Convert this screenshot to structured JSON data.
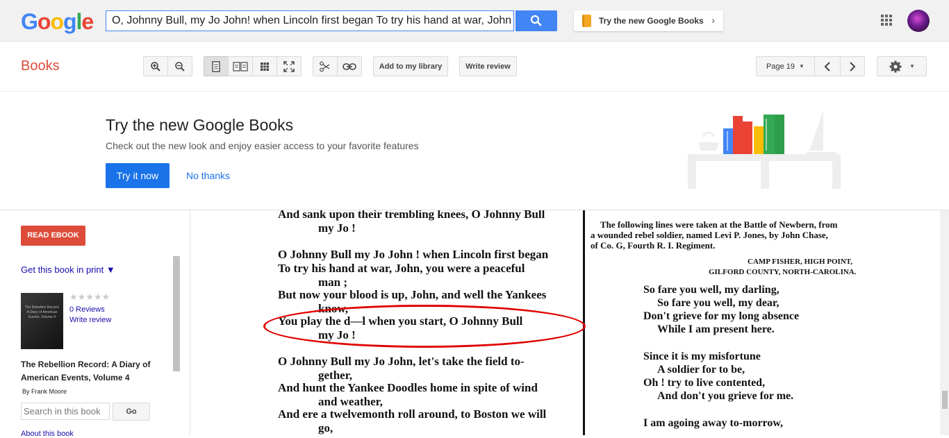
{
  "header": {
    "logo_letters": [
      {
        "ch": "G",
        "color": "#4285f4"
      },
      {
        "ch": "o",
        "color": "#ea4335"
      },
      {
        "ch": "o",
        "color": "#fbbc05"
      },
      {
        "ch": "g",
        "color": "#4285f4"
      },
      {
        "ch": "l",
        "color": "#34a853"
      },
      {
        "ch": "e",
        "color": "#ea4335"
      }
    ],
    "search_value": "O, Johnny Bull, my Jo John! when Lincoln first began To try his hand at war, John",
    "try_new_label": "Try the new Google Books"
  },
  "toolbar": {
    "books_label": "Books",
    "add_library_label": "Add to my library",
    "write_review_label": "Write review",
    "page_label": "Page 19"
  },
  "banner": {
    "title": "Try the new Google Books",
    "subtitle": "Check out the new look and enjoy easier access to your favorite features",
    "try_now_label": "Try it now",
    "no_thanks_label": "No thanks"
  },
  "sidebar": {
    "read_ebook_label": "READ EBOOK",
    "get_print_label": "Get this book in print ▼",
    "stars": "★★★★★",
    "reviews_label": "0 Reviews",
    "write_review_label": "Write review",
    "book_title": "The Rebellion Record: A Diary of American Events, Volume 4",
    "author": "By Frank Moore",
    "search_placeholder": "Search in this book",
    "go_label": "Go",
    "about_label": "About this book"
  },
  "scan": {
    "left_lines": [
      {
        "text": "And sank upon their trembling knees, O Johnny Bull",
        "indent": false
      },
      {
        "text": "my Jo !",
        "indent": true
      },
      {
        "text": "O Johnny Bull my Jo John ! when Lincoln first began",
        "indent": false
      },
      {
        "text": "To try his hand at war, John, you were a peaceful",
        "indent": false
      },
      {
        "text": "man ;",
        "indent": true
      },
      {
        "text": "But now your blood is up, John, and well the Yankees",
        "indent": false
      },
      {
        "text": "know,",
        "indent": true
      },
      {
        "text": "You play the d—l when you start, O Johnny Bull",
        "indent": false
      },
      {
        "text": "my Jo !",
        "indent": true
      },
      {
        "text": "O Johnny Bull my Jo John, let's take the field to-",
        "indent": false
      },
      {
        "text": "gether,",
        "indent": true
      },
      {
        "text": "And hunt the Yankee Doodles home in spite of wind",
        "indent": false
      },
      {
        "text": "and weather,",
        "indent": true
      },
      {
        "text": "And ere a twelvemonth roll around, to Boston we will",
        "indent": false
      },
      {
        "text": "go,",
        "indent": true
      }
    ],
    "right_header": [
      "The following lines were taken at the Battle of Newbern, from",
      "a wounded rebel soldier, named Levi P. Jones, by John Chase,",
      "of Co. G, Fourth R. I. Regiment."
    ],
    "right_place": [
      "CAMP FISHER, HIGH POINT,",
      "GILFORD COUNTY, NORTH-CAROLINA."
    ],
    "right_poem": [
      "So fare you well, my darling,",
      "So fare you well, my dear,",
      "Don't grieve for my long absence",
      "While I am present here.",
      "Since it is my misfortune",
      "A soldier for to be,",
      "Oh ! try to live contented,",
      "And don't you grieve for me.",
      "I am agoing away to-morrow,"
    ]
  }
}
